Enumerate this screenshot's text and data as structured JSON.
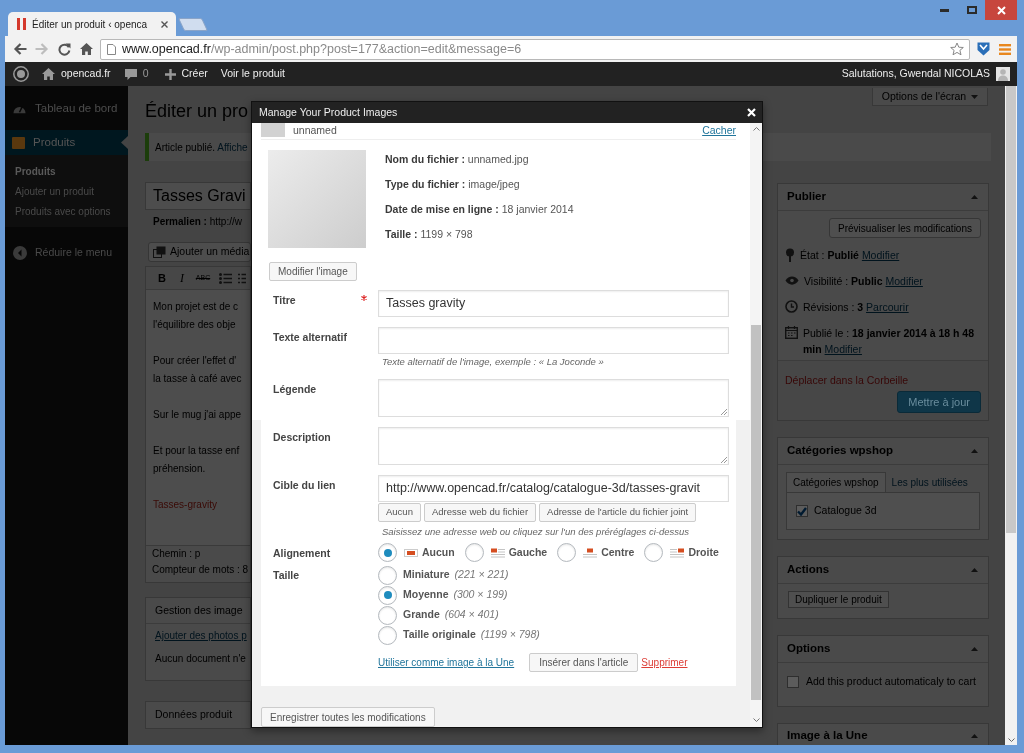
{
  "browser": {
    "tab": {
      "title": "Éditer un produit ‹ openca"
    },
    "url": {
      "host": "www.opencad.fr",
      "path": "/wp-admin/post.php?post=177&action=edit&message=6"
    }
  },
  "admin_bar": {
    "site": "opencad.fr",
    "comments": "0",
    "new": "Créer",
    "view": "Voir le produit",
    "greeting": "Salutations, Gwendal NICOLAS"
  },
  "sidebar": {
    "menu": [
      {
        "label": "Tableau de bord",
        "selected": false
      },
      {
        "label": "Produits",
        "selected": true
      }
    ],
    "submenu": [
      {
        "label": "Produits",
        "selected": true
      },
      {
        "label": "Ajouter un produit",
        "selected": false
      },
      {
        "label": "Produits avec options",
        "selected": false
      }
    ],
    "collapse": "Réduire le menu"
  },
  "page": {
    "heading": "Éditer un pro",
    "screen_options": "Options de l'écran",
    "notice": {
      "text": "Article publié.",
      "link": "Affiche"
    },
    "post_title": "Tasses Gravi",
    "permalink": {
      "label": "Permalien :",
      "url": "http://w"
    },
    "add_media": "Ajouter un média",
    "toolbar": [
      {
        "kind": "bold",
        "label": "B"
      },
      {
        "kind": "italic",
        "label": "I"
      },
      {
        "kind": "strike",
        "label": "ABC"
      }
    ],
    "editor_paragraphs": [
      {
        "kind": "text",
        "lines": [
          "Mon projet est de c",
          "l'équilibre des obje"
        ]
      },
      {
        "kind": "text",
        "lines": [
          "Pour créer l'effet d'",
          "la tasse à café avec"
        ]
      },
      {
        "kind": "text",
        "lines": [
          "Sur le mug j'ai appe"
        ]
      },
      {
        "kind": "text",
        "lines": [
          "Et pour la tasse enf",
          "préhension."
        ]
      },
      {
        "kind": "link",
        "lines": [
          "Tasses-gravity"
        ]
      }
    ],
    "path": "Chemin : p",
    "word_count": "Compteur de mots : 8",
    "main_boxes": [
      {
        "title": "Gestion des image",
        "link": "Ajouter des photos p",
        "text": "Aucun document n'e"
      },
      {
        "title": "Données produit"
      }
    ],
    "side_boxes": [
      {
        "kind": "publish",
        "title": "Publier",
        "preview": "Prévisualiser les modifications",
        "rows": [
          {
            "label": "État :",
            "value": "Publié",
            "link": "Modifier"
          },
          {
            "label": "Visibilité :",
            "value": "Public",
            "link": "Modifier"
          },
          {
            "label": "Révisions :",
            "value": "3",
            "link": "Parcourir"
          },
          {
            "label": "Publié le :",
            "value": "18 janvier 2014 à 18 h 48 min",
            "link": "Modifier"
          }
        ],
        "trash": "Déplacer dans la Corbeille",
        "update": "Mettre à jour"
      },
      {
        "kind": "categories",
        "title": "Catégories wpshop",
        "tabs": [
          {
            "label": "Catégories wpshop",
            "selected": true
          },
          {
            "label": "Les plus utilisées",
            "selected": false
          }
        ],
        "items": [
          {
            "label": "Catalogue 3d",
            "checked": true
          }
        ]
      },
      {
        "kind": "actions",
        "title": "Actions",
        "button": "Dupliquer le produit"
      },
      {
        "kind": "options",
        "title": "Options",
        "items": [
          {
            "label": "Add this product automaticaly to cart",
            "checked": false
          }
        ]
      },
      {
        "kind": "plain",
        "title": "Image à la Une"
      }
    ]
  },
  "modal": {
    "title": "Manage Your Product Images",
    "attachment": {
      "name": "unnamed",
      "toggle": "Cacher"
    },
    "file_info": [
      {
        "label": "Nom du fichier :",
        "value": "unnamed.jpg"
      },
      {
        "label": "Type du fichier :",
        "value": "image/jpeg"
      },
      {
        "label": "Date de mise en ligne :",
        "value": "18 janvier 2014"
      },
      {
        "label": "Taille :",
        "value": "1199 × 798"
      }
    ],
    "edit_image": "Modifier l'image",
    "fields": [
      {
        "kind": "input",
        "label": "Titre",
        "required": true,
        "value": "Tasses gravity"
      },
      {
        "kind": "input",
        "label": "Texte alternatif",
        "required": false,
        "help": "Texte alternatif de l'image, exemple : « La Joconde »"
      },
      {
        "kind": "textarea",
        "label": "Légende",
        "required": false
      },
      {
        "kind": "textarea",
        "label": "Description",
        "required": false
      },
      {
        "kind": "input",
        "label": "Cible du lien",
        "required": false,
        "value": "http://www.opencad.fr/catalog/catalogue-3d/tasses-gravit",
        "presets": [
          "Aucun",
          "Adresse web du fichier",
          "Adresse de l'article du fichier joint"
        ],
        "help": "Saisissez une adresse web ou cliquez sur l'un des préréglages ci-dessus"
      },
      {
        "kind": "align",
        "label": "Alignement",
        "required": false,
        "options": [
          {
            "label": "Aucun",
            "selected": true
          },
          {
            "label": "Gauche",
            "selected": false
          },
          {
            "label": "Centre",
            "selected": false
          },
          {
            "label": "Droite",
            "selected": false
          }
        ]
      },
      {
        "kind": "size",
        "label": "Taille",
        "required": false,
        "options": [
          {
            "label": "Miniature",
            "dims": "(221 × 221)",
            "selected": false
          },
          {
            "label": "Moyenne",
            "dims": "(300 × 199)",
            "selected": true
          },
          {
            "label": "Grande",
            "dims": "(604 × 401)",
            "selected": false
          },
          {
            "label": "Taille originale",
            "dims": "(1199 × 798)",
            "selected": false
          }
        ]
      }
    ],
    "featured_link": "Utiliser comme image à la Une",
    "insert": "Insérer dans l'article",
    "delete": "Supprimer",
    "save_all": "Enregistrer toutes les modifications"
  }
}
